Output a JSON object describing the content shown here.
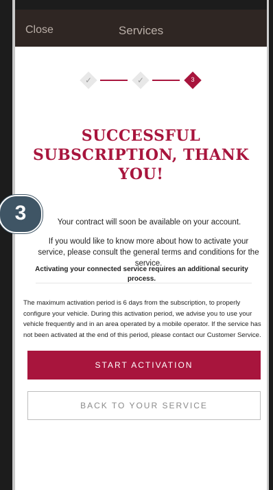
{
  "nav": {
    "close_label": "Close",
    "title": "Services"
  },
  "stepper": {
    "steps": [
      {
        "state": "done",
        "glyph": "✓"
      },
      {
        "state": "done",
        "glyph": "✓"
      },
      {
        "state": "active",
        "label": "3"
      }
    ],
    "accent_color": "#a8153d"
  },
  "headline": "SUCCESSFUL SUBSCRIPTION, THANK YOU!",
  "badge_label": "3",
  "messages": {
    "contract": "Your contract will soon be available on your account.",
    "info": "If you would like to know more about how to activate your service, please consult the general terms and conditions for the service.",
    "security": "Activating your connected service requires an additional security process.",
    "activation_period": "The maximum activation period is 6 days from the subscription, to properly configure your vehicle. During this activation period, we advise you to use your vehicle frequently and in an area operated by a mobile operator. If the service has not been activated at the end of this period, please contact our Customer Service."
  },
  "buttons": {
    "start_activation": "START ACTIVATION",
    "back_to_service": "BACK TO YOUR SERVICE"
  },
  "colors": {
    "brand": "#a8153d",
    "nav_background": "#2f2623",
    "badge_background": "#3f5565"
  }
}
